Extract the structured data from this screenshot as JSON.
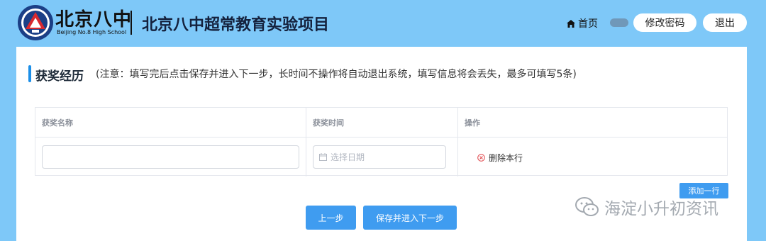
{
  "header": {
    "logo_script": "北京八中",
    "logo_en": "Beijing No.8 High School",
    "site_title": "北京八中超常教育实验项目",
    "home_label": "首页",
    "change_password_label": "修改密码",
    "logout_label": "退出"
  },
  "section": {
    "title": "获奖经历",
    "note": "(注意：填写完后点击保存并进入下一步，长时间不操作将自动退出系统，填写信息将会丢失，最多可填写5条)"
  },
  "table": {
    "columns": [
      "获奖名称",
      "获奖时间",
      "操作"
    ],
    "rows": [
      {
        "award_name": "",
        "date_placeholder": "选择日期",
        "delete_label": "删除本行"
      }
    ]
  },
  "actions": {
    "add_row_label": "添加一行",
    "prev_label": "上一步",
    "save_next_label": "保存并进入下一步"
  },
  "watermark": {
    "text": "海淀小升初资讯"
  },
  "colors": {
    "page_bg": "#7ec8f8",
    "accent": "#3f9cf0",
    "danger": "#e0484d"
  }
}
